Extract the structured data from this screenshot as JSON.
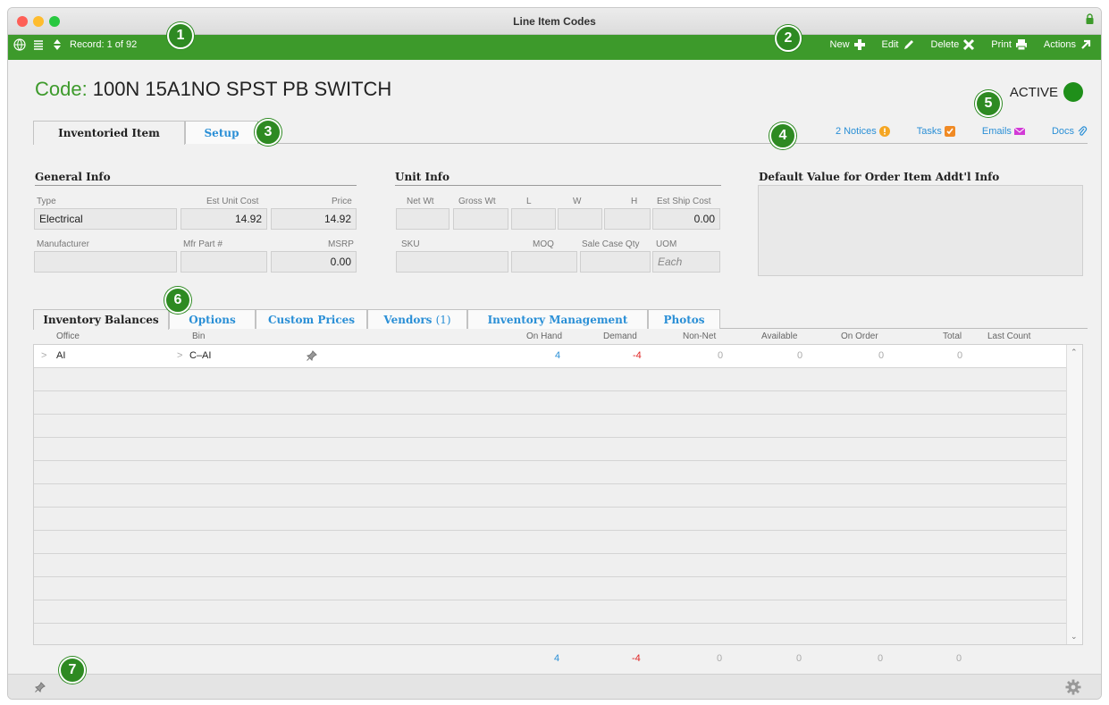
{
  "window": {
    "title": "Line Item Codes"
  },
  "toolbar": {
    "record_label": "Record: 1 of 92",
    "buttons": [
      {
        "label": "New",
        "icon": "plus-icon"
      },
      {
        "label": "Edit",
        "icon": "pencil-icon"
      },
      {
        "label": "Delete",
        "icon": "x-icon"
      },
      {
        "label": "Print",
        "icon": "printer-icon"
      },
      {
        "label": "Actions",
        "icon": "arrow-out-icon"
      }
    ]
  },
  "callouts": [
    "1",
    "2",
    "3",
    "4",
    "5",
    "6",
    "7"
  ],
  "header": {
    "code_label": "Code:",
    "code_value": "100N 15A1NO SPST PB SWITCH",
    "status": "ACTIVE"
  },
  "main_tabs": [
    {
      "label": "Inventoried Item"
    },
    {
      "label": "Setup"
    }
  ],
  "right_links": [
    {
      "label": "2 Notices",
      "icon": "warning-icon"
    },
    {
      "label": "Tasks",
      "icon": "check-icon"
    },
    {
      "label": "Emails",
      "icon": "envelope-icon"
    },
    {
      "label": "Docs",
      "icon": "paperclip-icon"
    }
  ],
  "general_info": {
    "title": "General Info",
    "labels": {
      "type": "Type",
      "est_unit_cost": "Est Unit Cost",
      "price": "Price",
      "manufacturer": "Manufacturer",
      "mfr_part": "Mfr Part #",
      "msrp": "MSRP"
    },
    "values": {
      "type": "Electrical",
      "est_unit_cost": "14.92",
      "price": "14.92",
      "manufacturer": "",
      "mfr_part": "",
      "msrp": "0.00"
    }
  },
  "unit_info": {
    "title": "Unit Info",
    "labels": {
      "net_wt": "Net Wt",
      "gross_wt": "Gross Wt",
      "l": "L",
      "w": "W",
      "h": "H",
      "est_ship_cost": "Est Ship Cost",
      "sku": "SKU",
      "moq": "MOQ",
      "sale_case_qty": "Sale Case Qty",
      "uom": "UOM"
    },
    "values": {
      "est_ship_cost": "0.00",
      "uom_placeholder": "Each"
    }
  },
  "default_value": {
    "title": "Default Value for Order Item Addt'l Info"
  },
  "sub_tabs": [
    {
      "label": "Inventory Balances"
    },
    {
      "label": "Options"
    },
    {
      "label": "Custom Prices"
    },
    {
      "label": "Vendors",
      "count": "(1)"
    },
    {
      "label": "Inventory Management"
    },
    {
      "label": "Photos"
    }
  ],
  "grid": {
    "columns": [
      "Office",
      "Bin",
      "On Hand",
      "Demand",
      "Non-Net",
      "Available",
      "On Order",
      "Total",
      "Last Count"
    ],
    "rows": [
      {
        "office_chevron": ">",
        "office": "AI",
        "bin_chevron": ">",
        "bin": "C–AI",
        "on_hand": "4",
        "demand": "-4",
        "non_net": "0",
        "available": "0",
        "on_order": "0",
        "total": "0",
        "last_count": ""
      }
    ]
  },
  "totals": {
    "on_hand": "4",
    "demand": "-4",
    "non_net": "0",
    "available": "0",
    "on_order": "0",
    "total": "0"
  },
  "colors": {
    "toolbar_green": "#3d9a2b",
    "link_blue": "#2a8fd6",
    "negative_red": "#e02424",
    "active_green": "#1f8f1a"
  }
}
